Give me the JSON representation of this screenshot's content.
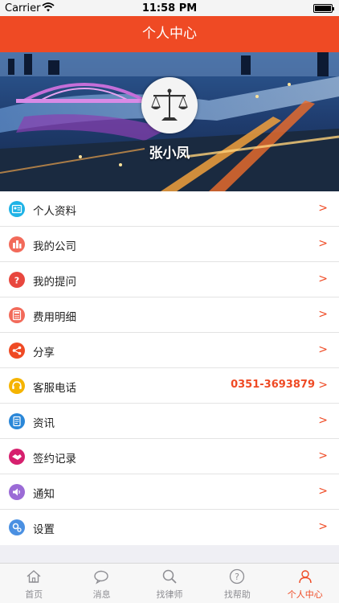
{
  "status_bar": {
    "carrier": "Carrier",
    "time": "11:58 PM"
  },
  "header": {
    "title": "个人中心"
  },
  "profile": {
    "name": "张小凤"
  },
  "menu": [
    {
      "label": "个人资料",
      "icon": "profile-card-icon",
      "color": "#1fb3e6"
    },
    {
      "label": "我的公司",
      "icon": "building-icon",
      "color": "#f26a5a"
    },
    {
      "label": "我的提问",
      "icon": "question-bubble-icon",
      "color": "#e8473e"
    },
    {
      "label": "费用明细",
      "icon": "calculator-icon",
      "color": "#f26a5a"
    },
    {
      "label": "分享",
      "icon": "share-icon",
      "color": "#ef4a24"
    },
    {
      "label": "客服电话",
      "icon": "headset-icon",
      "color": "#f5b400",
      "value": "0351-3693879"
    },
    {
      "label": "资讯",
      "icon": "document-icon",
      "color": "#2a87d8"
    },
    {
      "label": "签约记录",
      "icon": "handshake-icon",
      "color": "#d6206e"
    },
    {
      "label": "通知",
      "icon": "speaker-icon",
      "color": "#9b6bd6"
    },
    {
      "label": "设置",
      "icon": "gear-icon",
      "color": "#4a90e2"
    }
  ],
  "tabs": [
    {
      "label": "首页",
      "icon": "home-icon",
      "active": false
    },
    {
      "label": "消息",
      "icon": "chat-bubble-icon",
      "active": false
    },
    {
      "label": "找律师",
      "icon": "search-icon",
      "active": false
    },
    {
      "label": "找帮助",
      "icon": "help-icon",
      "active": false
    },
    {
      "label": "个人中心",
      "icon": "person-icon",
      "active": true
    }
  ],
  "colors": {
    "accent": "#ef4a24",
    "tab_inactive": "#8e8e93"
  }
}
